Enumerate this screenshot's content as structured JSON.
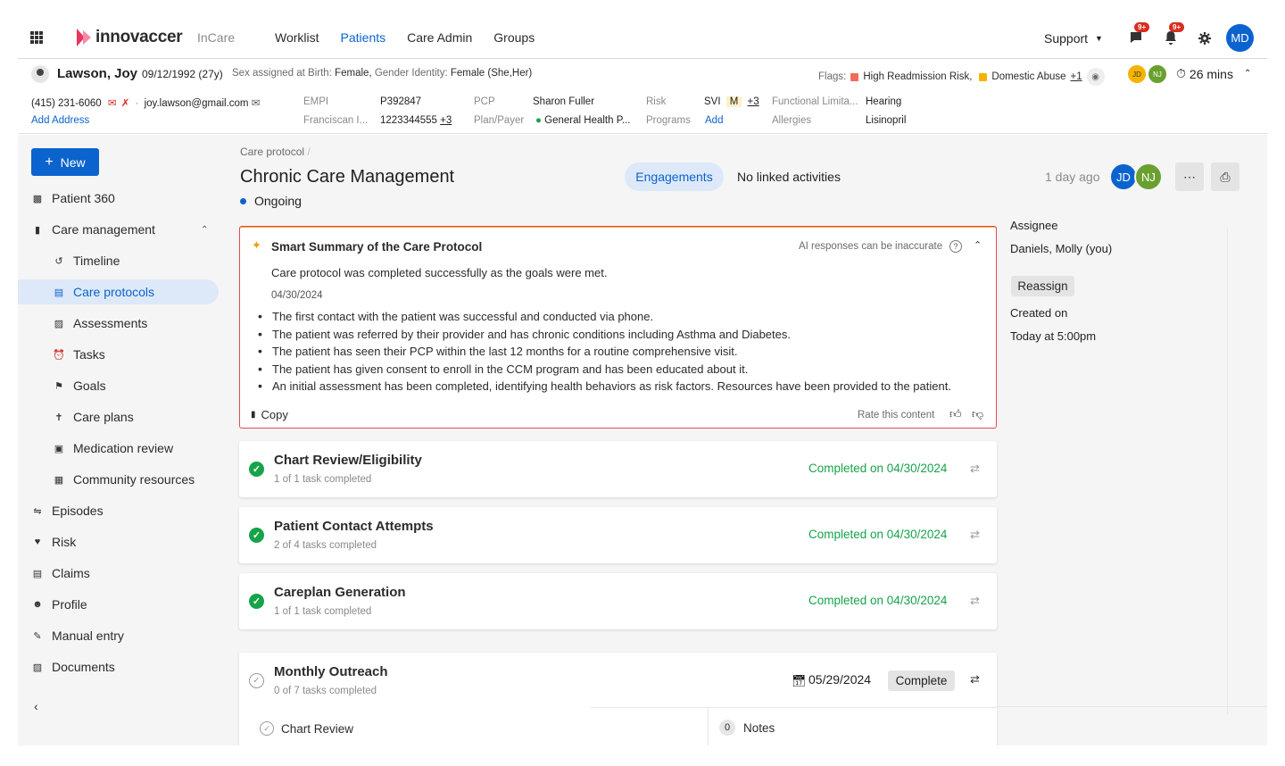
{
  "header": {
    "logo_text": "innovaccer",
    "product": "InCare",
    "nav": [
      "Worklist",
      "Patients",
      "Care Admin",
      "Groups"
    ],
    "active_nav": "Patients",
    "support": "Support",
    "chat_badge": "9+",
    "notif_badge": "9+",
    "user_initials": "MD"
  },
  "patient": {
    "name": "Lawson, Joy",
    "dob": "09/12/1992 (27y)",
    "sex_label": "Sex assigned at Birth:",
    "sex_value": "Female,",
    "gender_label": "Gender Identity:",
    "gender_value": "Female (She,Her)",
    "flags_label": "Flags:",
    "flag1": "High Readmission Risk,",
    "flag1_color": "#f26b5b",
    "flag2": "Domestic Abuse",
    "flag2_color": "#f5b301",
    "flag_more": "+1",
    "team1": "JD",
    "team2": "NJ",
    "timer": "26 mins"
  },
  "info": {
    "phone": "(415) 231-6060",
    "email": "joy.lawson@gmail.com",
    "add_address": "Add Address",
    "empi_label": "EMPI",
    "empi_value": "P392847",
    "org_label": "Franciscan I...",
    "org_value": "1223344555",
    "org_more": "+3",
    "pcp_label": "PCP",
    "pcp_value": "Sharon Fuller",
    "plan_label": "Plan/Payer",
    "plan_value": "General Health P...",
    "risk_label": "Risk",
    "svi_label": "SVI",
    "svi_level": "M",
    "svi_more": "+3",
    "programs_label": "Programs",
    "programs_add": "Add",
    "func_label": "Functional Limita...",
    "func_value": "Hearing",
    "allergies_label": "Allergies",
    "allergies_value": "Lisinopril"
  },
  "sidebar": {
    "new_label": "New",
    "items": [
      {
        "label": "Patient 360"
      },
      {
        "label": "Care management"
      },
      {
        "label": "Timeline"
      },
      {
        "label": "Care protocols"
      },
      {
        "label": "Assessments"
      },
      {
        "label": "Tasks"
      },
      {
        "label": "Goals"
      },
      {
        "label": "Care plans"
      },
      {
        "label": "Medication review"
      },
      {
        "label": "Community resources"
      },
      {
        "label": "Episodes"
      },
      {
        "label": "Risk"
      },
      {
        "label": "Claims"
      },
      {
        "label": "Profile"
      },
      {
        "label": "Manual entry"
      },
      {
        "label": "Documents"
      }
    ]
  },
  "protocol": {
    "breadcrumb": "Care protocol",
    "title": "Chronic Care Management",
    "status": "Ongoing",
    "engagements": "Engagements",
    "no_linked": "No linked activities",
    "updated": "1 day ago",
    "av1": "JD",
    "av2": "NJ"
  },
  "summary": {
    "title": "Smart Summary of the Care Protocol",
    "ai_note": "AI responses can be inaccurate",
    "body": "Care protocol was completed successfully as the goals were met.",
    "date": "04/30/2024",
    "points": [
      "The first contact with the patient was successful and conducted via phone.",
      "The patient was referred by their provider and has chronic conditions including Asthma and Diabetes.",
      "The patient has seen their PCP within the last 12 months for a routine comprehensive visit.",
      "The patient has given consent to enroll in the CCM program and has been educated about it.",
      "An initial assessment has been completed, identifying health behaviors as risk factors. Resources have been provided to the patient."
    ],
    "copy": "Copy",
    "rate": "Rate this content"
  },
  "tasks": [
    {
      "title": "Chart Review/Eligibility",
      "progress": "1 of 1 task completed",
      "status": "Completed on 04/30/2024"
    },
    {
      "title": "Patient Contact Attempts",
      "progress": "2 of 4 tasks completed",
      "status": "Completed on 04/30/2024"
    },
    {
      "title": "Careplan Generation",
      "progress": "1 of 1 task completed",
      "status": "Completed on 04/30/2024"
    }
  ],
  "outreach": {
    "title": "Monthly Outreach",
    "progress": "0 of 7 tasks completed",
    "due": "05/29/2024",
    "complete": "Complete",
    "subtask": "Chart Review",
    "notes_count": "0",
    "notes_label": "Notes"
  },
  "right": {
    "assignee_label": "Assignee",
    "assignee_value": "Daniels, Molly (you)",
    "reassign": "Reassign",
    "created_label": "Created on",
    "created_value": "Today at 5:00pm"
  },
  "colors": {
    "primary": "#0b63ce",
    "success": "#16a34a",
    "danger": "#d92d20"
  }
}
